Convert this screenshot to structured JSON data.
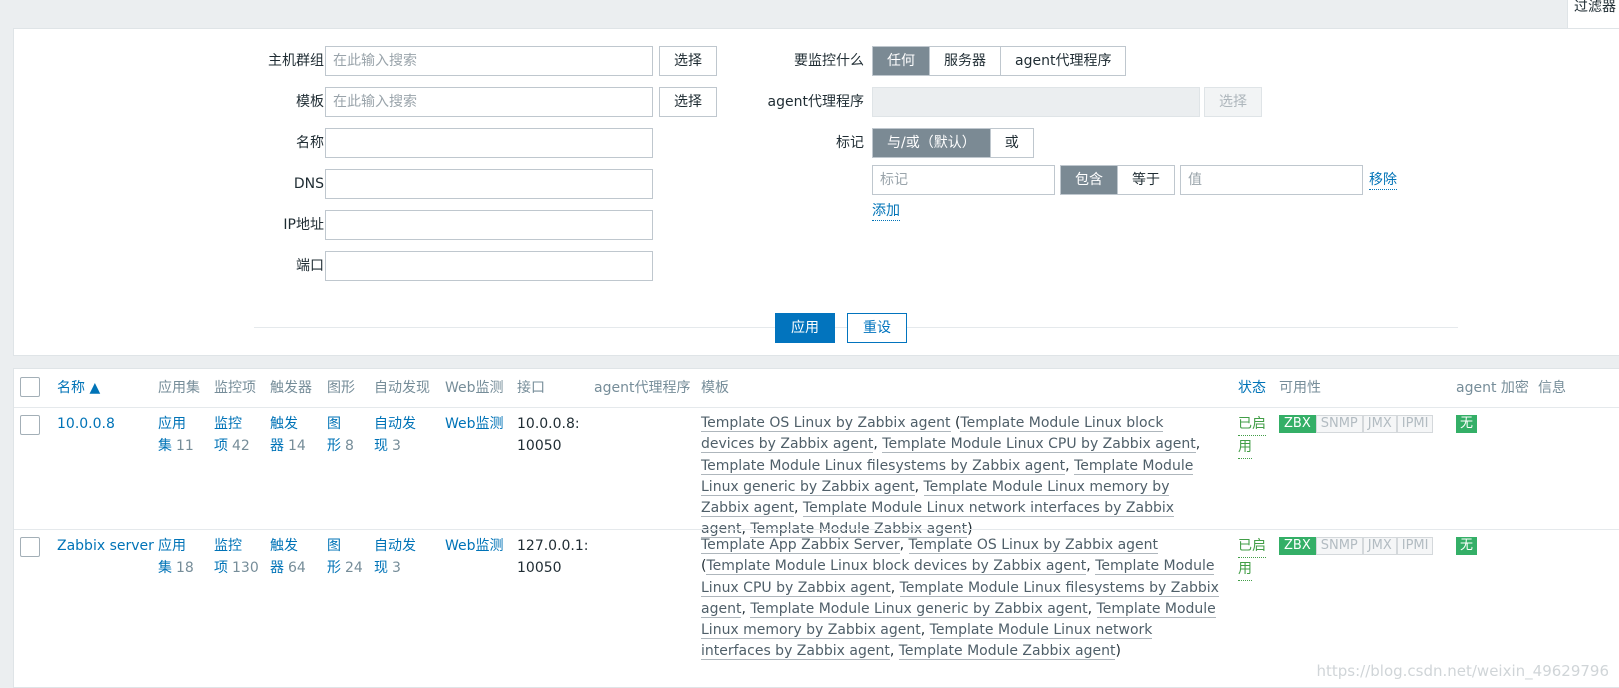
{
  "top_tab": {
    "label": "过滤器"
  },
  "filter": {
    "host_group": {
      "label": "主机群组",
      "placeholder": "在此输入搜索",
      "select": "选择"
    },
    "template": {
      "label": "模板",
      "placeholder": "在此输入搜索",
      "select": "选择"
    },
    "name": {
      "label": "名称",
      "value": ""
    },
    "dns": {
      "label": "DNS",
      "value": ""
    },
    "ip": {
      "label": "IP地址",
      "value": ""
    },
    "port": {
      "label": "端口",
      "value": ""
    },
    "monitored_by": {
      "label": "要监控什么",
      "options": [
        "任何",
        "服务器",
        "agent代理程序"
      ],
      "selected": "任何"
    },
    "proxy": {
      "label": "agent代理程序",
      "value": "",
      "select": "选择"
    },
    "tags": {
      "label": "标记",
      "mode_options": [
        "与/或（默认）",
        "或"
      ],
      "mode_selected": "与/或（默认）",
      "tag_placeholder": "标记",
      "op_options": [
        "包含",
        "等于"
      ],
      "op_selected": "包含",
      "value_placeholder": "值",
      "remove": "移除",
      "add": "添加"
    },
    "apply": "应用",
    "reset": "重设"
  },
  "table": {
    "headers": {
      "name": "名称 ▲",
      "applications": "应用集",
      "items": "监控项",
      "triggers": "触发器",
      "graphs": "图形",
      "discovery": "自动发现",
      "web": "Web监测",
      "interface": "接口",
      "proxy": "agent代理程序",
      "templates": "模板",
      "status": "状态",
      "availability": "可用性",
      "encryption": "agent 加密",
      "info": "信息"
    },
    "rows": [
      {
        "name": "10.0.0.8",
        "app_1": "应用",
        "app_2": "集",
        "app_count": "11",
        "items_1": "监控",
        "items_2": "项",
        "items_count": "42",
        "trig_1": "触发",
        "trig_2": "器",
        "trig_count": "14",
        "graph_1": "图",
        "graph_2": "形",
        "graph_count": "8",
        "disc_1": "自动发",
        "disc_2": "现",
        "disc_count": "3",
        "web": "Web监测",
        "iface_1": "10.0.0.8:",
        "iface_2": "10050",
        "status_1": "已启",
        "status_2": "用",
        "templates": {
          "main": [
            "Template OS Linux by Zabbix agent"
          ],
          "nested": [
            "Template Module Linux block devices by Zabbix agent",
            "Template Module Linux CPU by Zabbix agent",
            "Template Module Linux filesystems by Zabbix agent",
            "Template Module Linux generic by Zabbix agent",
            "Template Module Linux memory by Zabbix agent",
            "Template Module Linux network interfaces by Zabbix agent",
            "Template Module Zabbix agent"
          ]
        },
        "availability": [
          "ZBX",
          "SNMP",
          "JMX",
          "IPMI"
        ],
        "encryption": "无"
      },
      {
        "name": "Zabbix server",
        "app_1": "应用",
        "app_2": "集",
        "app_count": "18",
        "items_1": "监控",
        "items_2": "项",
        "items_count": "130",
        "trig_1": "触发",
        "trig_2": "器",
        "trig_count": "64",
        "graph_1": "图",
        "graph_2": "形",
        "graph_count": "24",
        "disc_1": "自动发",
        "disc_2": "现",
        "disc_count": "3",
        "web": "Web监测",
        "iface_1": "127.0.0.1:",
        "iface_2": "10050",
        "status_1": "已启",
        "status_2": "用",
        "templates": {
          "main": [
            "Template App Zabbix Server",
            "Template OS Linux by Zabbix agent"
          ],
          "nested": [
            "Template Module Linux block devices by Zabbix agent",
            "Template Module Linux CPU by Zabbix agent",
            "Template Module Linux filesystems by Zabbix agent",
            "Template Module Linux generic by Zabbix agent",
            "Template Module Linux memory by Zabbix agent",
            "Template Module Linux network interfaces by Zabbix agent",
            "Template Module Zabbix agent"
          ]
        },
        "availability": [
          "ZBX",
          "SNMP",
          "JMX",
          "IPMI"
        ],
        "encryption": "无"
      }
    ]
  },
  "watermark": "https://blog.csdn.net/weixin_49629796"
}
